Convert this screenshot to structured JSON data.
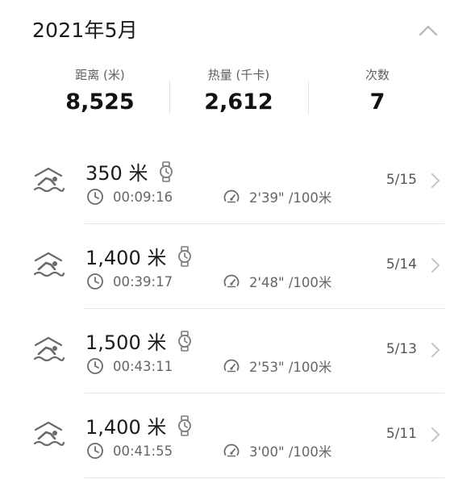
{
  "header": {
    "month": "2021年5月",
    "collapse_icon": "chevron-up-icon"
  },
  "summary": {
    "distance": {
      "label": "距离 (米)",
      "value": "8,525"
    },
    "calories": {
      "label": "热量 (千卡)",
      "value": "2,612"
    },
    "count": {
      "label": "次数",
      "value": "7"
    }
  },
  "records": [
    {
      "icon": "swimming-icon",
      "device_icon": "watch-icon",
      "distance": "350 米",
      "duration": "00:09:16",
      "pace": "2'39\" /100米",
      "date": "5/15"
    },
    {
      "icon": "swimming-icon",
      "device_icon": "watch-icon",
      "distance": "1,400 米",
      "duration": "00:39:17",
      "pace": "2'48\" /100米",
      "date": "5/14"
    },
    {
      "icon": "swimming-icon",
      "device_icon": "watch-icon",
      "distance": "1,500 米",
      "duration": "00:43:11",
      "pace": "2'53\" /100米",
      "date": "5/13"
    },
    {
      "icon": "swimming-icon",
      "device_icon": "watch-icon",
      "distance": "1,400 米",
      "duration": "00:41:55",
      "pace": "3'00\" /100米",
      "date": "5/11"
    }
  ],
  "colors": {
    "text_primary": "#1b1b1b",
    "text_secondary": "#666666",
    "icon": "#6b6b6b",
    "divider": "#e6e6e6",
    "chevron": "#c4c4c4"
  }
}
